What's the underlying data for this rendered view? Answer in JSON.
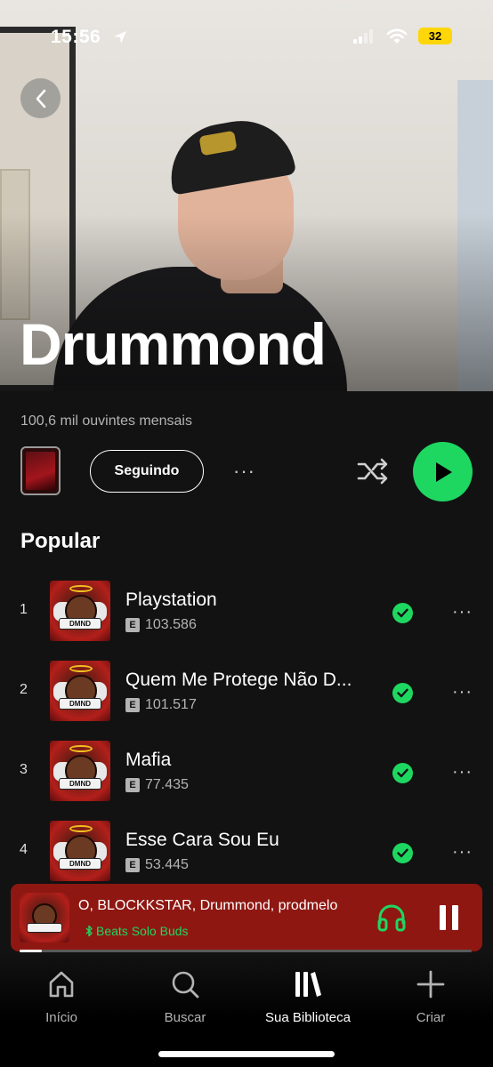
{
  "status_bar": {
    "time": "15:56",
    "battery": "32"
  },
  "artist": {
    "name": "Drummond",
    "monthly_listeners": "100,6 mil ouvintes mensais"
  },
  "actions": {
    "follow_label": "Seguindo",
    "more_label": "···"
  },
  "popular": {
    "title": "Popular",
    "tracks": [
      {
        "rank": "1",
        "title": "Playstation",
        "plays": "103.586",
        "explicit": "E",
        "saved": true
      },
      {
        "rank": "2",
        "title": "Quem Me Protege Não D...",
        "plays": "101.517",
        "explicit": "E",
        "saved": true
      },
      {
        "rank": "3",
        "title": "Mafia",
        "plays": "77.435",
        "explicit": "E",
        "saved": true
      },
      {
        "rank": "4",
        "title": "Esse Cara Sou Eu",
        "plays": "53.445",
        "explicit": "E",
        "saved": true
      }
    ],
    "cover_tag": "DMND"
  },
  "now_playing": {
    "title": "O, BLOCKKSTAR, Drummond, prodmelo",
    "device": "Beats Solo Buds",
    "progress": 0.05
  },
  "tabs": [
    {
      "label": "Início",
      "icon": "home-icon",
      "active": false
    },
    {
      "label": "Buscar",
      "icon": "search-icon",
      "active": false
    },
    {
      "label": "Sua Biblioteca",
      "icon": "library-icon",
      "active": true
    },
    {
      "label": "Criar",
      "icon": "plus-icon",
      "active": false
    }
  ],
  "colors": {
    "accent": "#1ed760",
    "background": "#121212",
    "now_playing_bg": "#8e1712"
  }
}
